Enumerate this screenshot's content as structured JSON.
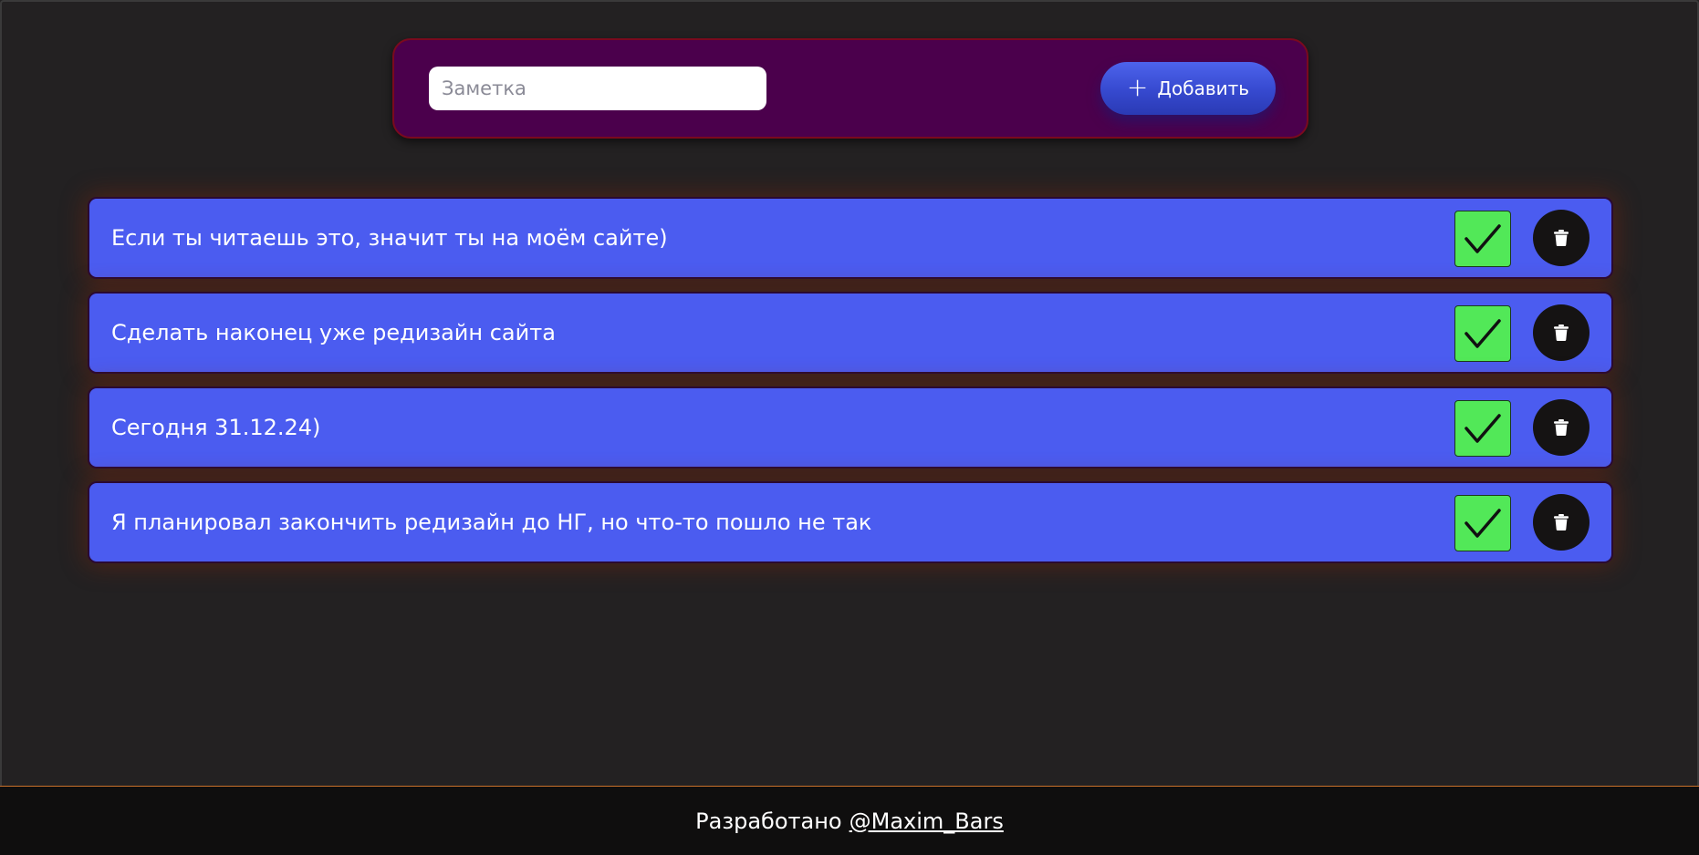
{
  "add_form": {
    "input_placeholder": "Заметка",
    "input_value": "",
    "add_button_label": "Добавить",
    "add_button_icon": "plus-icon"
  },
  "notes": [
    {
      "text": "Если ты читаешь это, значит ты на моём сайте)"
    },
    {
      "text": "Сделать наконец уже редизайн сайта"
    },
    {
      "text": "Сегодня 31.12.24)"
    },
    {
      "text": "Я планировал закончить редизайн до НГ, но что-то пошло не так"
    }
  ],
  "note_actions": {
    "done_icon": "checkmark-icon",
    "delete_icon": "trash-icon"
  },
  "footer": {
    "prefix": "Разработано",
    "link_text": "@Maxim_Bars"
  },
  "colors": {
    "background": "#232122",
    "panel": "#4b004c",
    "note": "#4b5cf0",
    "done": "#52e858",
    "delete": "#151313",
    "footer": "#0f0e0e",
    "accent_line": "#c9702a"
  }
}
